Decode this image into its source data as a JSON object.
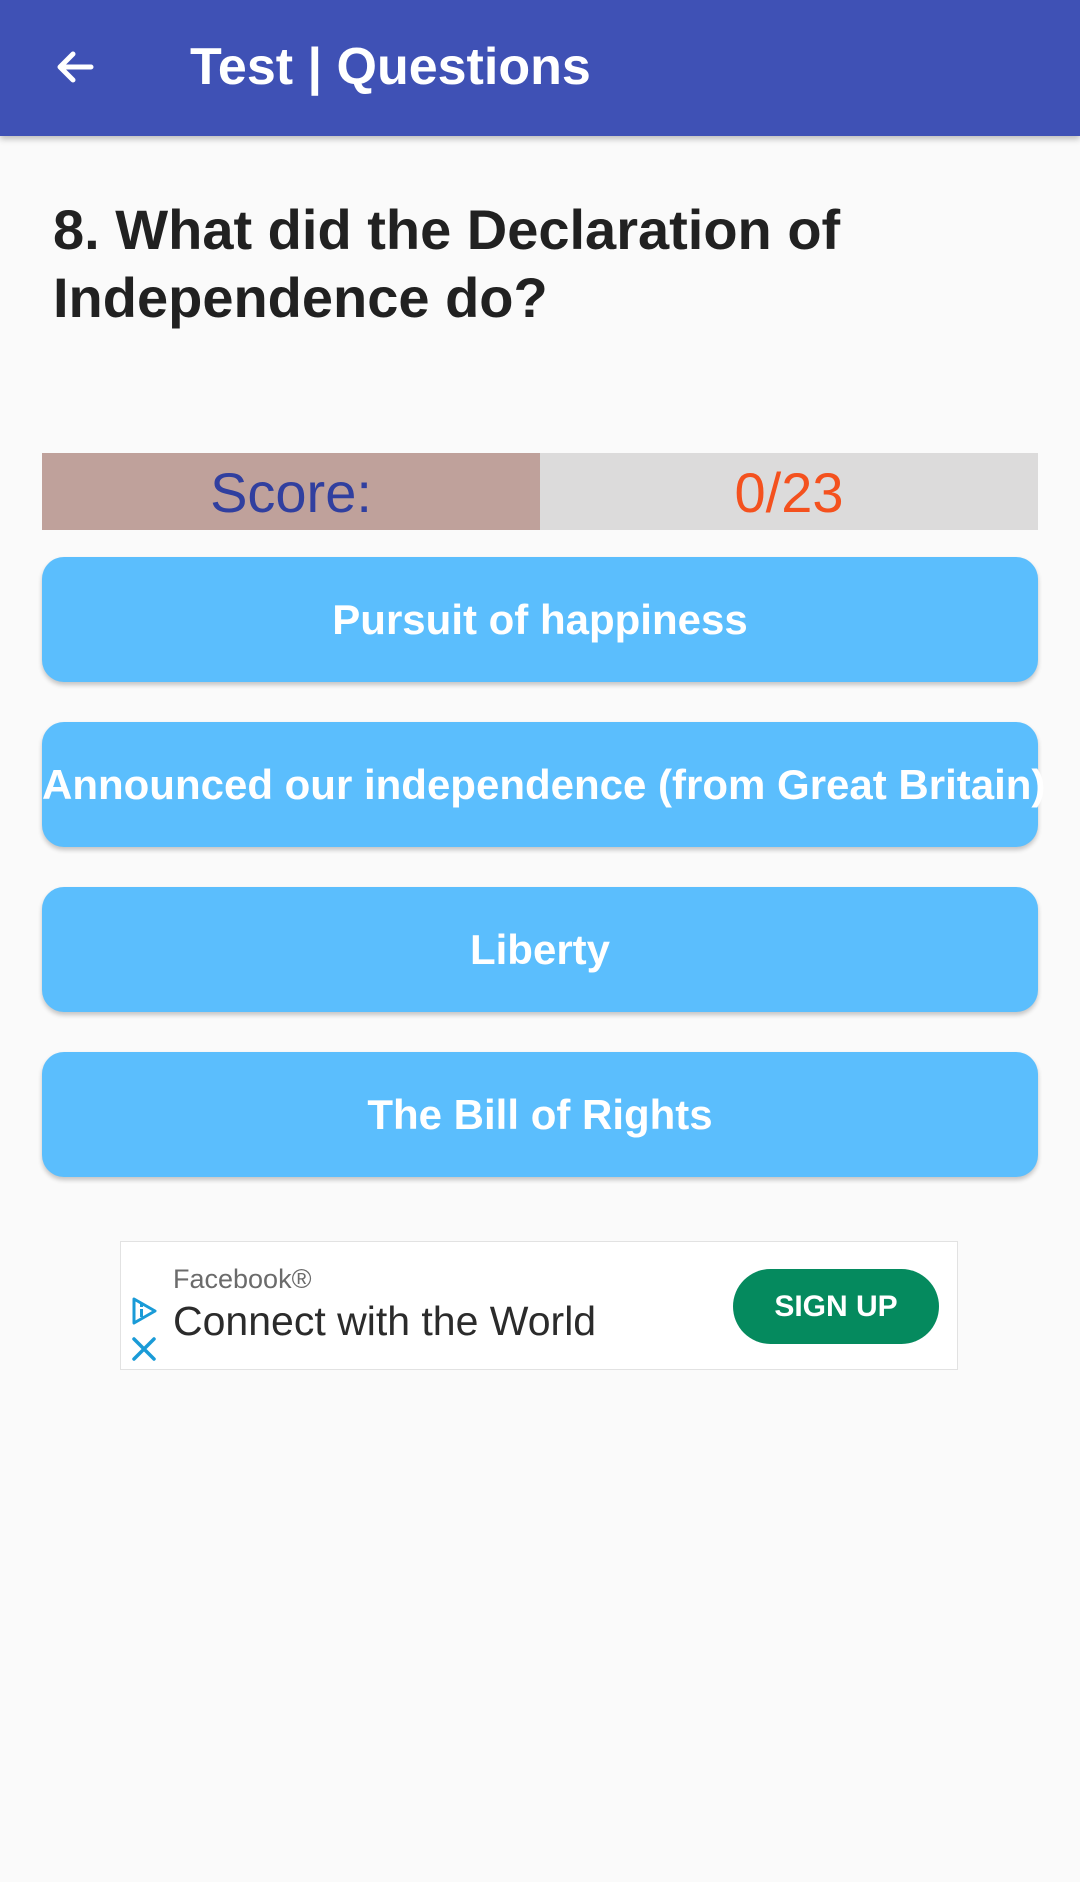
{
  "appbar": {
    "back_icon": "arrow-left-icon",
    "title": "Test | Questions",
    "color": "#3f51b5"
  },
  "question": {
    "text": "8. What did the Declaration of Independence do?"
  },
  "score": {
    "label": "Score:",
    "value": "0/23",
    "label_color": "#303f9f",
    "value_color": "#f4511e"
  },
  "answers": [
    {
      "label": "Pursuit of happiness"
    },
    {
      "label": "Announced our independence (from Great Britain)"
    },
    {
      "label": "Liberty"
    },
    {
      "label": "The Bill of Rights"
    }
  ],
  "answer_color": "#5bbefd",
  "ad": {
    "brand": "Facebook®",
    "headline": "Connect with the World",
    "cta": "SIGN UP",
    "cta_color": "#058a5e",
    "adchoices_icon": "adchoices-icon",
    "close_icon": "close-icon"
  }
}
